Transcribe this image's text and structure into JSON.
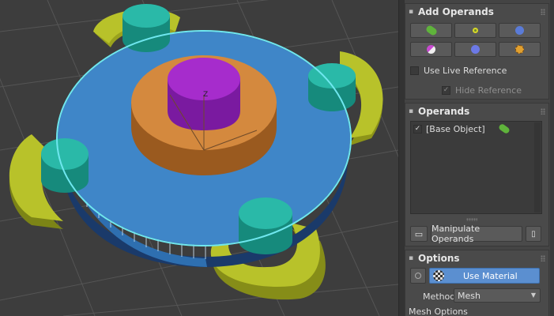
{
  "viewport": {
    "gizmo_axis_label": "Z",
    "colors": {
      "background": "#3d3d3d",
      "grid": "#555555",
      "blue_disk": "#3f86c8",
      "orange_disk": "#d4893e",
      "purple_cylinder": "#a62ccc",
      "teal_cylinder": "#2ab9a8",
      "yellow_shape": "#b8c22a",
      "selection": "#6fe7ef"
    }
  },
  "add_operands": {
    "title": "Add Operands",
    "buttons": [
      {
        "icon": "union-green-icon",
        "color": "#5fb33b"
      },
      {
        "icon": "intersect-yellow-icon",
        "color": "#d7d52a"
      },
      {
        "icon": "subtract-blue-icon",
        "color": "#5a7bd8"
      },
      {
        "icon": "merge-magenta-icon",
        "color": "#c84ad0"
      },
      {
        "icon": "attach-blue-icon",
        "color": "#6c79e6"
      },
      {
        "icon": "insert-orange-icon",
        "color": "#e0a030"
      },
      {
        "icon": "imprint-orange-icon",
        "color": "#e07a2e"
      }
    ],
    "use_live_reference": {
      "label": "Use Live Reference",
      "checked": false
    },
    "hide_reference": {
      "label": "Hide Reference",
      "checked": true,
      "disabled": true
    }
  },
  "operands": {
    "title": "Operands",
    "items": [
      {
        "label": "[Base Object]",
        "checked": true,
        "icon": "union-green-icon"
      }
    ],
    "manipulate_label": "Manipulate Operands"
  },
  "options": {
    "title": "Options",
    "use_material_label": "Use Material",
    "method_label": "Method",
    "method_value": "Mesh",
    "mesh_options_label": "Mesh Options"
  }
}
